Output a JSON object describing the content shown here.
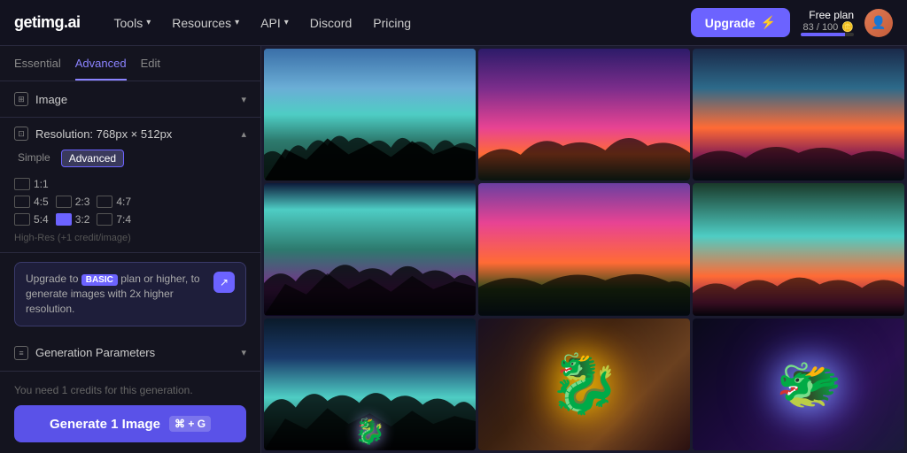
{
  "header": {
    "logo": "getimg.ai",
    "nav": [
      {
        "label": "Tools",
        "hasDropdown": true
      },
      {
        "label": "Resources",
        "hasDropdown": true
      },
      {
        "label": "API",
        "hasDropdown": true
      },
      {
        "label": "Discord",
        "hasDropdown": false
      },
      {
        "label": "Pricing",
        "hasDropdown": false
      }
    ],
    "upgrade_btn": "Upgrade",
    "plan": {
      "label": "Free plan",
      "credits_used": "83",
      "credits_total": "100"
    }
  },
  "sidebar": {
    "tabs": [
      {
        "label": "Essential",
        "active": false
      },
      {
        "label": "Advanced",
        "active": true
      },
      {
        "label": "Edit",
        "active": false
      }
    ],
    "image_section": {
      "label": "Image",
      "icon": "image-icon"
    },
    "resolution_section": {
      "label": "Resolution: 768px × 512px",
      "icon": "resolution-icon",
      "toggle": {
        "simple": "Simple",
        "advanced": "Advanced"
      },
      "ratios": [
        {
          "label": "1:1",
          "selected": false
        },
        {
          "label": "4:5",
          "selected": false
        },
        {
          "label": "2:3",
          "selected": false
        },
        {
          "label": "4:7",
          "selected": false
        },
        {
          "label": "5:4",
          "selected": false
        },
        {
          "label": "3:2",
          "selected": true
        },
        {
          "label": "7:4",
          "selected": false
        }
      ],
      "high_res_note": "High-Res (+1 credit/image)"
    },
    "upgrade_banner": {
      "text_before": "Upgrade to",
      "badge": "BASIC",
      "text_after": "plan or higher, to generate images with 2x higher resolution.",
      "arrow": "↗"
    },
    "gen_params": {
      "label": "Generation Parameters",
      "icon": "params-icon"
    },
    "footer": {
      "credits_note": "You need 1 credits for this generation.",
      "generate_btn": "Generate 1 Image",
      "shortcut": "⌘ + G"
    }
  },
  "gallery": {
    "items": [
      {
        "id": 1,
        "type": "landscape",
        "desc": "Teal tropical lake sunset"
      },
      {
        "id": 2,
        "type": "landscape",
        "desc": "Purple pink sunset palms"
      },
      {
        "id": 3,
        "type": "landscape",
        "desc": "Orange teal twilight coast"
      },
      {
        "id": 4,
        "type": "landscape",
        "desc": "Teal reflection palms"
      },
      {
        "id": 5,
        "type": "landscape",
        "desc": "Purple orange sunset palms"
      },
      {
        "id": 6,
        "type": "landscape",
        "desc": "Cyan sunset beach"
      },
      {
        "id": 7,
        "type": "landscape",
        "desc": "Dark teal lake palms"
      },
      {
        "id": 8,
        "type": "dragon",
        "desc": "Gold dragon fantasy"
      },
      {
        "id": 9,
        "type": "dragon",
        "desc": "Blue purple dragon fantasy"
      }
    ]
  }
}
